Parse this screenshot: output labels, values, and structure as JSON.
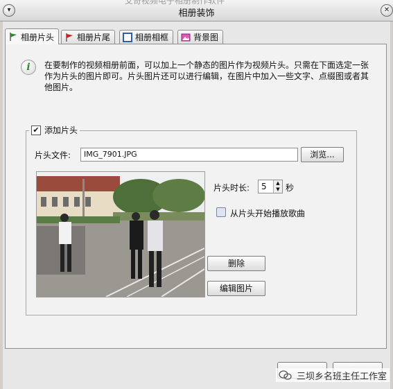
{
  "window": {
    "title": "相册装饰",
    "ghost_title": "艾奇视频电子相册制作软件"
  },
  "tabs": [
    {
      "label": "相册片头",
      "icon": "green-flag-icon",
      "active": true
    },
    {
      "label": "相册片尾",
      "icon": "red-flag-icon",
      "active": false
    },
    {
      "label": "相册相框",
      "icon": "frame-icon",
      "active": false
    },
    {
      "label": "背景图",
      "icon": "pink-image-icon",
      "active": false
    }
  ],
  "info": {
    "text": "在要制作的视频相册前面，可以加上一个静态的图片作为视频片头。只需在下面选定一张作为片头的图片即可。片头图片还可以进行编辑，在图片中加入一些文字、点缀图或者其他图片。"
  },
  "group": {
    "checkbox_label": "添加片头",
    "checked": true
  },
  "file": {
    "label": "片头文件:",
    "value": "IMG_7901.JPG",
    "browse_label": "浏览..."
  },
  "duration": {
    "label": "片头时长:",
    "value": "5",
    "unit": "秒"
  },
  "music": {
    "label": "从片头开始播放歌曲",
    "checked": false
  },
  "buttons": {
    "delete_label": "删除",
    "edit_label": "编辑图片"
  },
  "watermark": {
    "text": "三坝乡名班主任工作室"
  },
  "colors": {
    "accent_green": "#2e8b2e",
    "window_bg": "#d4d0c8",
    "panel_bg": "#f2f2f2"
  }
}
